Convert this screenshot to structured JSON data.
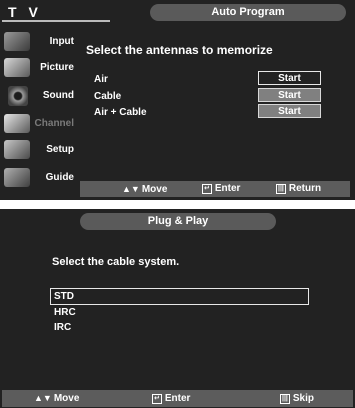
{
  "screen1": {
    "tv_label": "T V",
    "title": "Auto Program",
    "sidebar": [
      {
        "label": "Input",
        "icon": "input-icon"
      },
      {
        "label": "Picture",
        "icon": "picture-icon"
      },
      {
        "label": "Sound",
        "icon": "sound-icon"
      },
      {
        "label": "Channel",
        "icon": "channel-icon"
      },
      {
        "label": "Setup",
        "icon": "setup-icon"
      },
      {
        "label": "Guide",
        "icon": "guide-icon"
      }
    ],
    "heading": "Select the antennas to memorize",
    "options": [
      {
        "label": "Air",
        "button": "Start",
        "focused": true
      },
      {
        "label": "Cable",
        "button": "Start",
        "focused": false
      },
      {
        "label": "Air + Cable",
        "button": "Start",
        "focused": false
      }
    ],
    "bottom_bar": {
      "move": "Move",
      "enter": "Enter",
      "return": "Return"
    }
  },
  "screen2": {
    "title": "Plug & Play",
    "heading": "Select the cable system.",
    "options": [
      "STD",
      "HRC",
      "IRC"
    ],
    "selected": "STD",
    "bottom_bar": {
      "move": "Move",
      "enter": "Enter",
      "skip": "Skip"
    }
  }
}
